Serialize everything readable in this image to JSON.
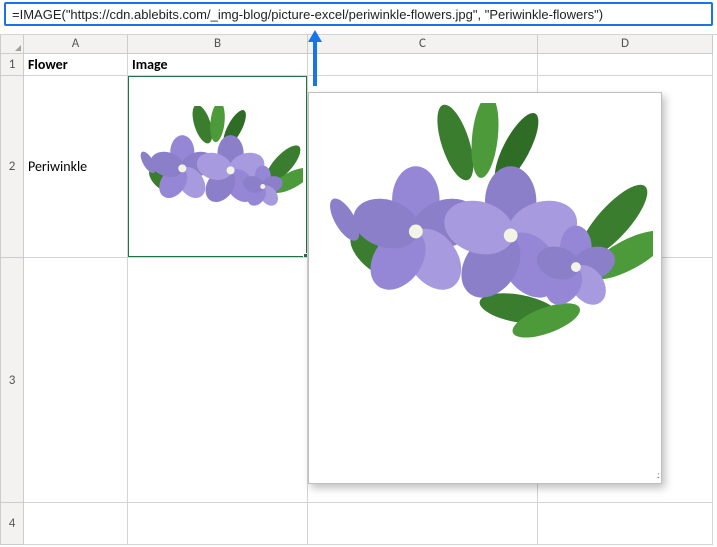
{
  "formula_bar": {
    "text": "=IMAGE(\"https://cdn.ablebits.com/_img-blog/picture-excel/periwinkle-flowers.jpg\", \"Periwinkle-flowers\")"
  },
  "columns": {
    "A": "A",
    "B": "B",
    "C": "C",
    "D": "D"
  },
  "rows": {
    "1": "1",
    "2": "2",
    "3": "3",
    "4": "4"
  },
  "cells": {
    "A1": "Flower",
    "B1": "Image",
    "A2": "Periwinkle"
  },
  "image_alt": "Periwinkle-flowers",
  "selected_cell": "B2"
}
